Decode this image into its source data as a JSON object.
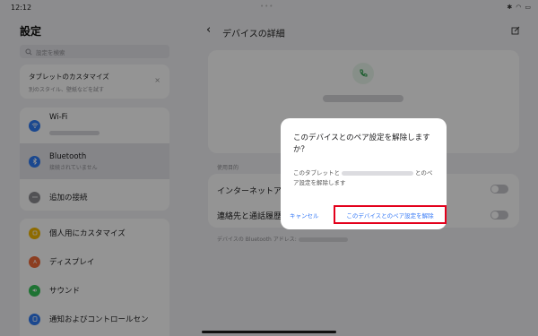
{
  "status": {
    "time": "12:12"
  },
  "left": {
    "title": "設定",
    "search_placeholder": "設定を検索",
    "promo": {
      "title": "タブレットのカスタマイズ",
      "subtitle": "別のスタイル、壁紙などを試す",
      "close": "×"
    },
    "connections": [
      {
        "label": "Wi‑Fi",
        "icon": "wifi-icon",
        "color": "#2f7cf6"
      },
      {
        "label": "Bluetooth",
        "sub": "接続されていません",
        "icon": "bluetooth-icon",
        "color": "#2f7cf6"
      },
      {
        "label": "追加の接続",
        "icon": "more-icon",
        "color": "#8e8e93"
      }
    ],
    "personal": [
      {
        "label": "個人用にカスタマイズ",
        "icon": "customize-icon",
        "color": "#f5b800"
      },
      {
        "label": "ディスプレイ",
        "icon": "display-icon",
        "color": "#f26b3a"
      },
      {
        "label": "サウンド",
        "icon": "sound-icon",
        "color": "#34c759"
      },
      {
        "label": "通知およびコントロールセン",
        "icon": "notification-icon",
        "color": "#2f7cf6"
      }
    ]
  },
  "right": {
    "page_title": "デバイスの詳細",
    "section_label": "使用目的",
    "rows": [
      {
        "label": "インターネットア"
      },
      {
        "label": "連絡先と通話履歴"
      }
    ],
    "footer_prefix": "デバイスの Bluetooth アドレス: "
  },
  "dialog": {
    "title": "このデバイスとのペア設定を解除しますか？",
    "body_prefix": "このタブレットと",
    "body_suffix": "とのペア設定を解除します",
    "cancel": "キャンセル",
    "confirm": "このデバイスとのペア設定を解除"
  },
  "colors": {
    "accent": "#3478f6",
    "highlight_border": "#e3001b",
    "selected_bg": "#e5e5ea"
  }
}
